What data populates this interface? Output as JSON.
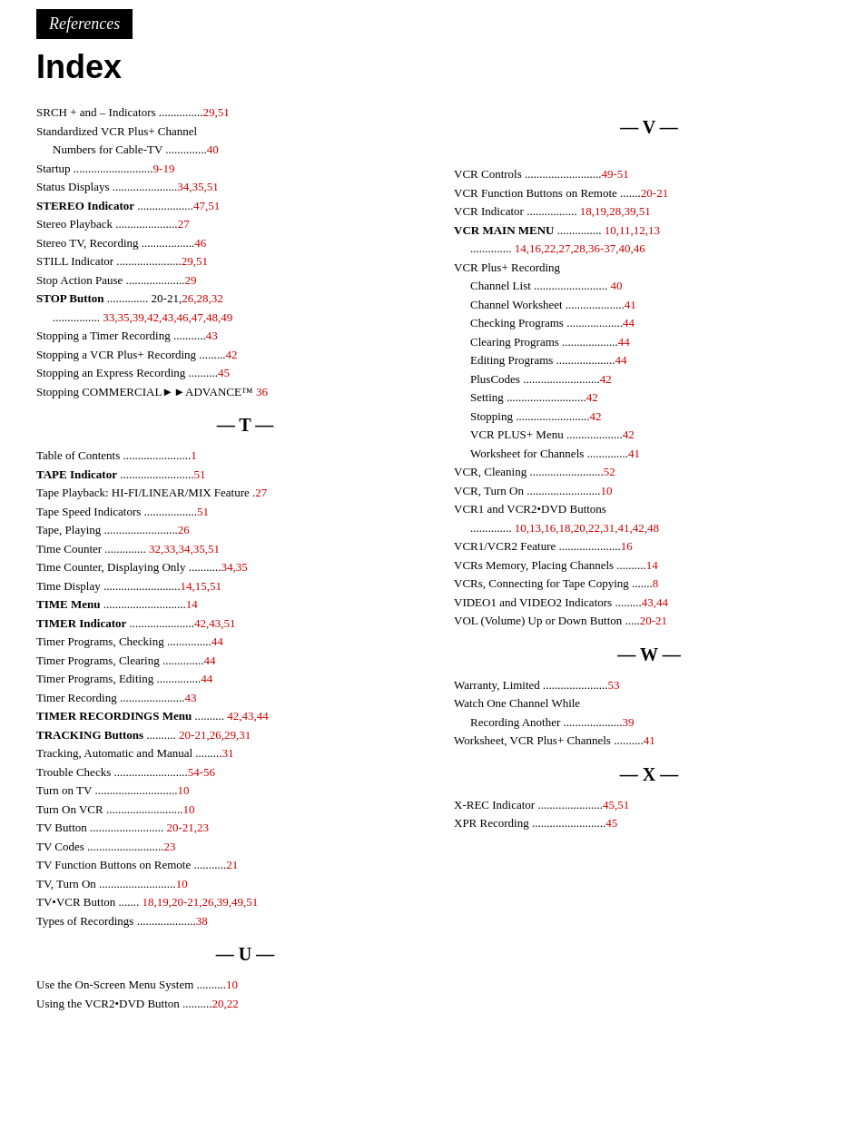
{
  "header": {
    "label": "References"
  },
  "title": "Index",
  "left_column": {
    "entries": [
      {
        "text": "SRCH + and – Indicators ...............",
        "pages": "29,51"
      },
      {
        "text": "Standardized VCR Plus+ Channel",
        "pages": ""
      },
      {
        "text": "Numbers for Cable-TV ..............",
        "pages": "40",
        "indent": 1
      },
      {
        "text": "Startup  ...........................",
        "pages": "9-19"
      },
      {
        "text": "Status Displays ......................",
        "pages": "34,35,51"
      },
      {
        "text": "STEREO Indicator .....................",
        "pages": "47,51",
        "bold": true
      },
      {
        "text": "Stereo Playback  .....................",
        "pages": "27"
      },
      {
        "text": "Stereo TV, Recording ..................",
        "pages": "46"
      },
      {
        "text": "STILL Indicator  ......................",
        "pages": "29,51"
      },
      {
        "text": "Stop Action Pause  ....................",
        "pages": "29"
      },
      {
        "text": "STOP Button  .............. 20-21,26,28,32",
        "pages": "",
        "bold": true
      },
      {
        "text": "................ 33,35,39,42,43,46,47,48,49",
        "pages": "",
        "cont": true
      },
      {
        "text": "Stopping a Timer Recording  ...........",
        "pages": "43"
      },
      {
        "text": "Stopping a VCR Plus+ Recording .........",
        "pages": "42"
      },
      {
        "text": "Stopping an Express Recording ..........",
        "pages": "45"
      },
      {
        "text": "Stopping COMMERCIAL▶▶ADVANCE™",
        "pages": "36"
      }
    ]
  },
  "t_section": {
    "divider": "— T —",
    "entries": [
      {
        "text": "Table of Contents .......................",
        "pages": "1"
      },
      {
        "text": "TAPE Indicator .........................",
        "pages": "51",
        "bold": true
      },
      {
        "text": "Tape Playback: HI-FI/LINEAR/MIX Feature .",
        "pages": "27"
      },
      {
        "text": "Tape Speed Indicators ..................",
        "pages": "51"
      },
      {
        "text": "Tape, Playing  .........................",
        "pages": "26"
      },
      {
        "text": "Time Counter  .............. 32,33,34,35,51",
        "pages": ""
      },
      {
        "text": "Time Counter, Displaying Only ...........",
        "pages": "34,35"
      },
      {
        "text": "Time Display  ..........................",
        "pages": "14,15,51"
      },
      {
        "text": "TIME Menu  ............................",
        "pages": "14",
        "bold": true
      },
      {
        "text": "TIMER Indicator  ......................",
        "pages": "42,43,51",
        "bold": true
      },
      {
        "text": "Timer Programs, Checking ...............",
        "pages": "44"
      },
      {
        "text": "Timer Programs, Clearing  ..............",
        "pages": "44"
      },
      {
        "text": "Timer Programs, Editing  ...............",
        "pages": "44"
      },
      {
        "text": "Timer Recording  ......................",
        "pages": "43"
      },
      {
        "text": "TIMER RECORDINGS Menu .......... 42,43,44",
        "pages": "",
        "bold": true
      },
      {
        "text": "TRACKING Buttons .......... 20-21,26,29,31",
        "pages": "",
        "bold": true
      },
      {
        "text": "Tracking, Automatic and Manual .........",
        "pages": "31"
      },
      {
        "text": "Trouble Checks .........................",
        "pages": "54-56"
      },
      {
        "text": "Turn on TV ............................",
        "pages": "10"
      },
      {
        "text": "Turn On VCR ..........................",
        "pages": "10"
      },
      {
        "text": "TV Button  ......................... 20-21,23",
        "pages": ""
      },
      {
        "text": "TV Codes ..........................",
        "pages": "23"
      },
      {
        "text": "TV Function Buttons on Remote ...........",
        "pages": "21"
      },
      {
        "text": "TV, Turn On  ..........................",
        "pages": "10"
      },
      {
        "text": "TV•VCR Button ....... 18,19,20-21,26,39,49,51",
        "pages": ""
      },
      {
        "text": "Types of Recordings ....................",
        "pages": "38"
      }
    ]
  },
  "u_section": {
    "divider": "— U —",
    "entries": [
      {
        "text": "Use the On-Screen Menu System  ..........",
        "pages": "10"
      },
      {
        "text": "Using the VCR2•DVD Button ..........",
        "pages": "20,22"
      }
    ]
  },
  "v_section": {
    "divider": "— V —",
    "entries": [
      {
        "text": "VCR Controls  ..........................",
        "pages": "49-51"
      },
      {
        "text": "VCR Function Buttons on Remote .......",
        "pages": "20-21"
      },
      {
        "text": "VCR Indicator ................. 18,19,28,39,51"
      },
      {
        "text": "VCR MAIN MENU ............... 10,11,12,13",
        "bold": true
      },
      {
        "text": ".............. 14,16,22,27,28,36-37,40,46",
        "cont": true
      },
      {
        "text": "VCR Plus+ Recording",
        "subheader": true
      },
      {
        "text": "Channel List .........................",
        "pages": "40",
        "indent": 1
      },
      {
        "text": "Channel Worksheet ....................",
        "pages": "41",
        "indent": 1
      },
      {
        "text": "Checking Programs ...................",
        "pages": "44",
        "indent": 1
      },
      {
        "text": "Clearing Programs  ...................",
        "pages": "44",
        "indent": 1
      },
      {
        "text": "Editing Programs  ....................",
        "pages": "44",
        "indent": 1
      },
      {
        "text": "PlusCodes ..........................",
        "pages": "42",
        "indent": 1
      },
      {
        "text": "Setting ...........................",
        "pages": "42",
        "indent": 1
      },
      {
        "text": "Stopping .........................",
        "pages": "42",
        "indent": 1
      },
      {
        "text": "VCR PLUS+ Menu ...................",
        "pages": "42",
        "indent": 1
      },
      {
        "text": "Worksheet for Channels ..............",
        "pages": "41",
        "indent": 1
      },
      {
        "text": "VCR, Cleaning  .........................",
        "pages": "52"
      },
      {
        "text": "VCR, Turn On  .........................",
        "pages": "10"
      },
      {
        "text": "VCR1 and VCR2•DVD Buttons",
        "subheader": true
      },
      {
        "text": ".............. 10,13,16,18,20,22,31,41,42,48",
        "cont": true
      },
      {
        "text": "VCR1/VCR2 Feature .....................",
        "pages": "16"
      },
      {
        "text": "VCRs Memory, Placing Channels ..........",
        "pages": "14"
      },
      {
        "text": "VCRs, Connecting for Tape Copying .......",
        "pages": "8"
      },
      {
        "text": "VIDEO1 and VIDEO2 Indicators .........",
        "pages": "43,44"
      },
      {
        "text": "VOL (Volume) Up or Down Button .....",
        "pages": "20-21"
      }
    ]
  },
  "w_section": {
    "divider": "— W —",
    "entries": [
      {
        "text": "Warranty, Limited  ......................",
        "pages": "53"
      },
      {
        "text": "Watch One Channel While",
        "subheader": true
      },
      {
        "text": "Recording Another  ....................",
        "pages": "39",
        "indent": 1
      },
      {
        "text": "Worksheet, VCR Plus+ Channels ..........",
        "pages": "41"
      }
    ]
  },
  "x_section": {
    "divider": "— X —",
    "entries": [
      {
        "text": "X-REC Indicator  ......................",
        "pages": "45,51"
      },
      {
        "text": "XPR Recording .........................",
        "pages": "45"
      }
    ]
  }
}
